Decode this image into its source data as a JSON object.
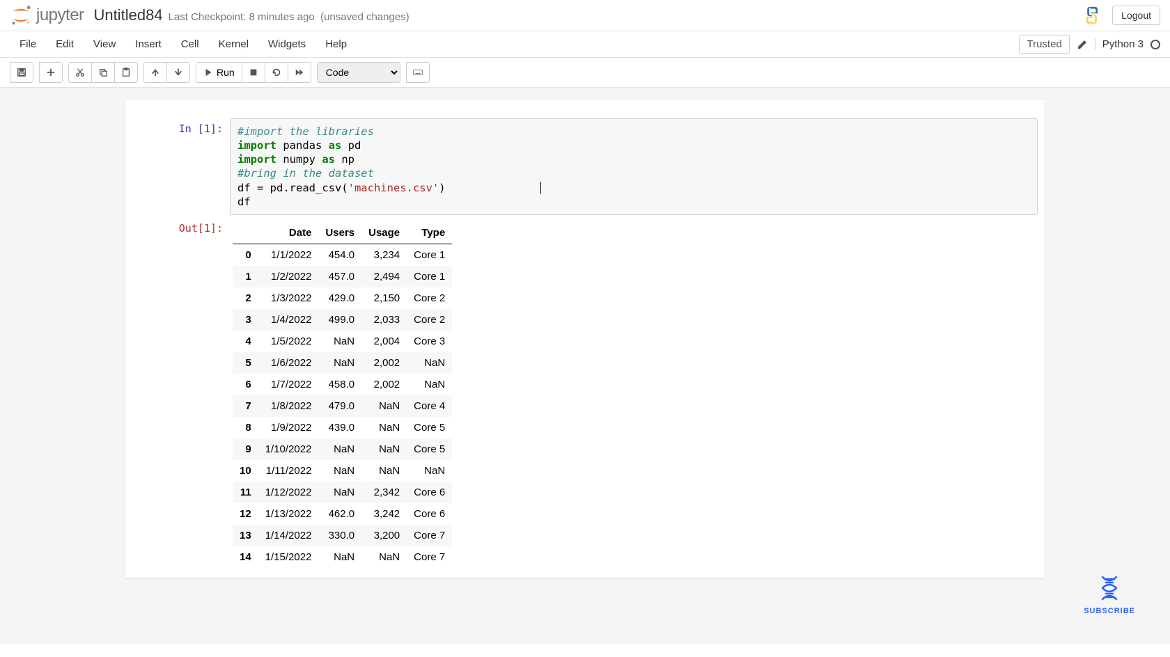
{
  "header": {
    "logo_text": "jupyter",
    "notebook_title": "Untitled84",
    "checkpoint": "Last Checkpoint: 8 minutes ago",
    "unsaved": "(unsaved changes)",
    "logout": "Logout"
  },
  "menubar": {
    "items": [
      "File",
      "Edit",
      "View",
      "Insert",
      "Cell",
      "Kernel",
      "Widgets",
      "Help"
    ],
    "trusted": "Trusted",
    "kernel": "Python 3"
  },
  "toolbar": {
    "run_label": "Run",
    "celltype": "Code"
  },
  "cell": {
    "in_prompt": "In [1]:",
    "out_prompt": "Out[1]:",
    "code": {
      "l1": "#import the libraries",
      "l2a": "import",
      "l2b": " pandas ",
      "l2c": "as",
      "l2d": " pd",
      "l3a": "import",
      "l3b": " numpy ",
      "l3c": "as",
      "l3d": " np",
      "l4": "#bring in the dataset",
      "l5a": "df = pd.read_csv(",
      "l5b": "'machines.csv'",
      "l5c": ")",
      "l6": "df"
    }
  },
  "dataframe": {
    "columns": [
      "",
      "Date",
      "Users",
      "Usage",
      "Type"
    ],
    "rows": [
      {
        "idx": "0",
        "date": "1/1/2022",
        "users": "454.0",
        "usage": "3,234",
        "type": "Core 1"
      },
      {
        "idx": "1",
        "date": "1/2/2022",
        "users": "457.0",
        "usage": "2,494",
        "type": "Core 1"
      },
      {
        "idx": "2",
        "date": "1/3/2022",
        "users": "429.0",
        "usage": "2,150",
        "type": "Core 2"
      },
      {
        "idx": "3",
        "date": "1/4/2022",
        "users": "499.0",
        "usage": "2,033",
        "type": "Core 2"
      },
      {
        "idx": "4",
        "date": "1/5/2022",
        "users": "NaN",
        "usage": "2,004",
        "type": "Core 3"
      },
      {
        "idx": "5",
        "date": "1/6/2022",
        "users": "NaN",
        "usage": "2,002",
        "type": "NaN"
      },
      {
        "idx": "6",
        "date": "1/7/2022",
        "users": "458.0",
        "usage": "2,002",
        "type": "NaN"
      },
      {
        "idx": "7",
        "date": "1/8/2022",
        "users": "479.0",
        "usage": "NaN",
        "type": "Core 4"
      },
      {
        "idx": "8",
        "date": "1/9/2022",
        "users": "439.0",
        "usage": "NaN",
        "type": "Core 5"
      },
      {
        "idx": "9",
        "date": "1/10/2022",
        "users": "NaN",
        "usage": "NaN",
        "type": "Core 5"
      },
      {
        "idx": "10",
        "date": "1/11/2022",
        "users": "NaN",
        "usage": "NaN",
        "type": "NaN"
      },
      {
        "idx": "11",
        "date": "1/12/2022",
        "users": "NaN",
        "usage": "2,342",
        "type": "Core 6"
      },
      {
        "idx": "12",
        "date": "1/13/2022",
        "users": "462.0",
        "usage": "3,242",
        "type": "Core 6"
      },
      {
        "idx": "13",
        "date": "1/14/2022",
        "users": "330.0",
        "usage": "3,200",
        "type": "Core 7"
      },
      {
        "idx": "14",
        "date": "1/15/2022",
        "users": "NaN",
        "usage": "NaN",
        "type": "Core 7"
      }
    ]
  },
  "subscribe": {
    "label": "SUBSCRIBE"
  }
}
